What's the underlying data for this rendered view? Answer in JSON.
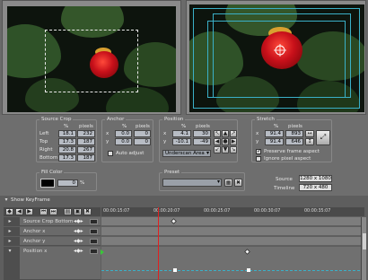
{
  "source_crop": {
    "title": "Source Crop",
    "col_pct": "%",
    "col_px": "pixels",
    "rows": [
      {
        "label": "Left",
        "pct": "18.1",
        "px": "232"
      },
      {
        "label": "Top",
        "pct": "17.3",
        "px": "187"
      },
      {
        "label": "Right",
        "pct": "20.8",
        "px": "267"
      },
      {
        "label": "Bottom",
        "pct": "17.3",
        "px": "187"
      }
    ]
  },
  "anchor": {
    "title": "Anchor",
    "col_pct": "%",
    "col_px": "pixels",
    "rows": [
      {
        "label": "x",
        "pct": "0.0",
        "px": "0"
      },
      {
        "label": "y",
        "pct": "0.0",
        "px": "0"
      }
    ],
    "auto_adjust": "Auto adjust"
  },
  "position": {
    "title": "Position",
    "col_pct": "%",
    "col_px": "pixels",
    "rows": [
      {
        "label": "x",
        "pct": "4.1",
        "px": "30"
      },
      {
        "label": "y",
        "pct": "-10.1",
        "px": "-49"
      }
    ],
    "area_select": "Underscan Area"
  },
  "stretch": {
    "title": "Stretch",
    "col_pct": "%",
    "col_px": "pixels",
    "rows": [
      {
        "label": "x",
        "pct": "91.4",
        "px": "893"
      },
      {
        "label": "y",
        "pct": "91.4",
        "px": "646"
      }
    ],
    "preserve_frame": "Preserve frame aspect",
    "ignore_pixel": "Ignore pixel aspect"
  },
  "fill_color": {
    "title": "Fill Color",
    "value": "0",
    "unit": "%"
  },
  "preset": {
    "title": "Preset"
  },
  "info": {
    "source_label": "Source",
    "source_value": "1280 x 1080",
    "timeline_label": "Timeline",
    "timeline_value": "720 x 480"
  },
  "keyframes": {
    "show_label": "Show KeyFrame",
    "ruler_ticks": [
      "00:00:15:07",
      "00:00:20:07",
      "00:00:25:07",
      "00:00:30:07",
      "00:00:35:07"
    ],
    "tracks": [
      {
        "label": "Source Crop Bottom"
      },
      {
        "label": "Anchor x"
      },
      {
        "label": "Anchor y"
      },
      {
        "label": "Position x"
      }
    ]
  },
  "colors": {
    "accent": "#3ab0c8",
    "panel": "#6e6e6e",
    "playhead": "#e02020"
  }
}
